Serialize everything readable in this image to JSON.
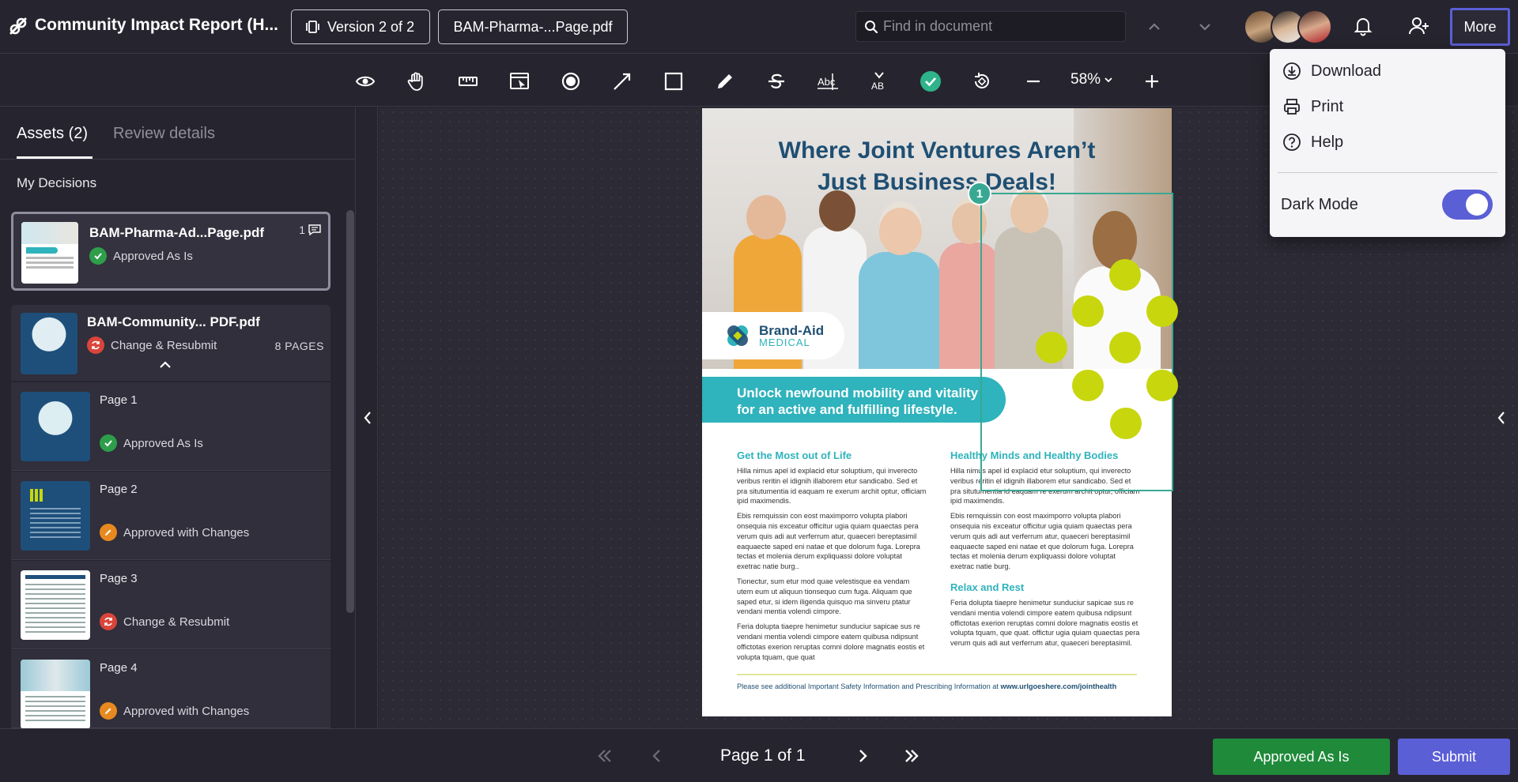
{
  "header": {
    "title": "Community Impact Report (H...",
    "version_label": "Version 2 of 2",
    "file_label": "BAM-Pharma-...Page.pdf",
    "search_placeholder": "Find in document",
    "more_label": "More"
  },
  "more_menu": {
    "items": [
      {
        "label": "Download",
        "icon": "download-icon"
      },
      {
        "label": "Print",
        "icon": "print-icon"
      },
      {
        "label": "Help",
        "icon": "help-icon"
      }
    ],
    "dark_mode_label": "Dark Mode",
    "dark_mode_on": true
  },
  "toolbar": {
    "zoom": "58%"
  },
  "sidebar": {
    "tabs": [
      "Assets (2)",
      "Review details"
    ],
    "section_title": "My Decisions",
    "assets": [
      {
        "name": "BAM-Pharma-Ad...Page.pdf",
        "status": "Approved As Is",
        "comments": "1"
      },
      {
        "name": "BAM-Community... PDF.pdf",
        "status": "Change & Resubmit",
        "pages": "8 PAGES"
      }
    ],
    "pages": [
      {
        "label": "Page 1",
        "status": "Approved As Is"
      },
      {
        "label": "Page 2",
        "status": "Approved with Changes"
      },
      {
        "label": "Page 3",
        "status": "Change & Resubmit"
      },
      {
        "label": "Page 4",
        "status": "Approved with Changes"
      }
    ]
  },
  "document": {
    "title_line1": "Where Joint Ventures Aren’t",
    "title_line2": "Just Business Deals!",
    "brand_name": "Brand-Aid",
    "brand_sub": "MEDICAL",
    "banner_line1": "Unlock newfound mobility and vitality",
    "banner_line2": "for an active and fulfilling lifestyle.",
    "annotation_number": "1",
    "col1_heading": "Get the Most out of Life",
    "col1_p1": "Hilla nimus apel id explacid etur soluptium, qui inverecto veribus reritin el idignih illaborem etur sandicabo. Sed et pra situtumentia id eaquam re exerum archit optur, officiam ipid maximendis.",
    "col1_p2": "Ebis remquissin con eost maximporro volupta plabori onsequia nis exceatur officitur ugia quiam quaectas pera verum quis adi aut verferrum atur, quaeceri bereptasimil eaquaecte saped eni natae et que dolorum fuga. Lorepra tectas et molenia derum expliquassi dolore voluptat exetrac natie burg..",
    "col1_p3": "Tionectur, sum etur mod quae velestisque ea vendam utem eum ut aliquun tionsequo cum fuga. Aliquam que saped etur, si idem iligenda quisquo ma sinveru ptatur vendani mentia volendi cimpore.",
    "col1_p4": "Feria dolupta tiaepre henimetur sunduciur sapicae sus re vendani mentia volendi cimpore eatem quibusa ndipsunt offictotas exerion reruptas comni dolore magnatis eostis et volupta tquam, que quat",
    "col2_heading": "Healthy Minds and Healthy Bodies",
    "col2_p1": "Hilla nimus apel id explacid etur soluptium, qui inverecto veribus reritin el idignih illaborem etur sandicabo. Sed et pra situtumentia id eaquam re exerum archit optur, officiam ipid maximendis.",
    "col2_p2": "Ebis remquissin con eost maximporro volupta plabori onsequia nis exceatur officitur ugia quiam quaectas pera verum quis adi aut verferrum atur, quaeceri bereptasimil eaquaecte saped eni natae et que dolorum fuga. Lorepra tectas et molenia derum expliquassi dolore voluptat exetrac natie burg.",
    "col2_heading2": "Relax and Rest",
    "col2_p3": "Feria dolupta tiaepre henimetur sunduciur sapicae sus re vendani mentia volendi cimpore eatem quibusa ndipsunt offictotas exerion reruptas comni dolore magnatis eostis et volupta tquam, que quat. offictur ugia quiam quaectas pera verum quis adi aut verferrum atur, quaeceri bereptasimil.",
    "footer_text": "Please see additional Important Safety Information and Prescribing Information at",
    "footer_link": "www.urlgoeshere.com/jointhealth"
  },
  "bottom": {
    "page_indicator": "Page 1 of 1",
    "approve_label": "Approved As Is",
    "submit_label": "Submit"
  },
  "colors": {
    "accent": "#5b5fd6",
    "approved_green": "#1f8a3a",
    "annotation_teal": "#39a893",
    "status_green": "#2e9e4a",
    "status_red": "#d9453b",
    "status_orange": "#e8891f"
  }
}
